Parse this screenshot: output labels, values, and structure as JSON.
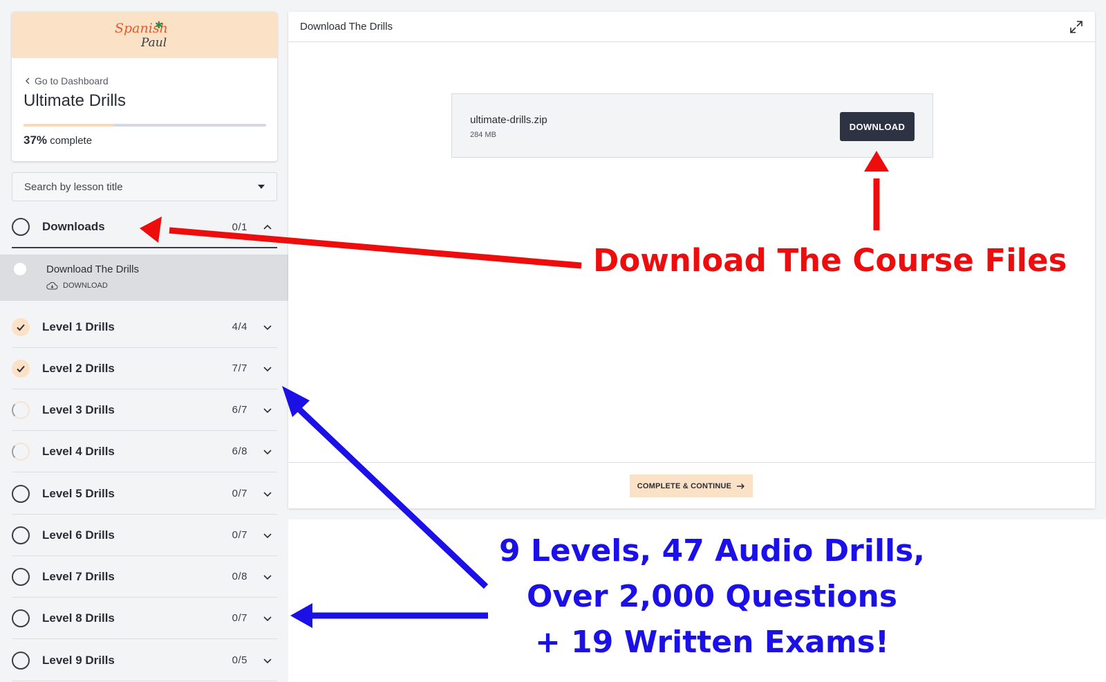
{
  "sidebar": {
    "logo_top": "Spanish",
    "logo_bottom": "Paul",
    "back_link": "Go to Dashboard",
    "course_title": "Ultimate Drills",
    "progress_percent": 37,
    "progress_value": "37%",
    "progress_label": "complete",
    "search_placeholder": "Search by lesson title",
    "chapters": [
      {
        "name": "Downloads",
        "count": "0/1",
        "status": "empty",
        "open": true
      },
      {
        "name": "Level 1 Drills",
        "count": "4/4",
        "status": "done"
      },
      {
        "name": "Level 2 Drills",
        "count": "7/7",
        "status": "done"
      },
      {
        "name": "Level 3 Drills",
        "count": "6/7",
        "status": "partial"
      },
      {
        "name": "Level 4 Drills",
        "count": "6/8",
        "status": "partial"
      },
      {
        "name": "Level 5 Drills",
        "count": "0/7",
        "status": "empty"
      },
      {
        "name": "Level 6 Drills",
        "count": "0/7",
        "status": "empty"
      },
      {
        "name": "Level 7 Drills",
        "count": "0/8",
        "status": "empty"
      },
      {
        "name": "Level 8 Drills",
        "count": "0/7",
        "status": "empty"
      },
      {
        "name": "Level 9 Drills",
        "count": "0/5",
        "status": "empty"
      }
    ],
    "active_lesson": {
      "title": "Download The Drills",
      "type": "DOWNLOAD"
    }
  },
  "main": {
    "title": "Download The Drills",
    "file_name": "ultimate-drills.zip",
    "file_size": "284 MB",
    "download_label": "DOWNLOAD",
    "complete_label": "COMPLETE & CONTINUE"
  },
  "annotations": {
    "red_text": "Download The Course Files",
    "blue_lines": [
      "9 Levels, 47 Audio Drills,",
      "Over 2,000 Questions",
      "+ 19 Written Exams!"
    ],
    "red_color": "#ee0d0d",
    "blue_color": "#1b10e6"
  }
}
